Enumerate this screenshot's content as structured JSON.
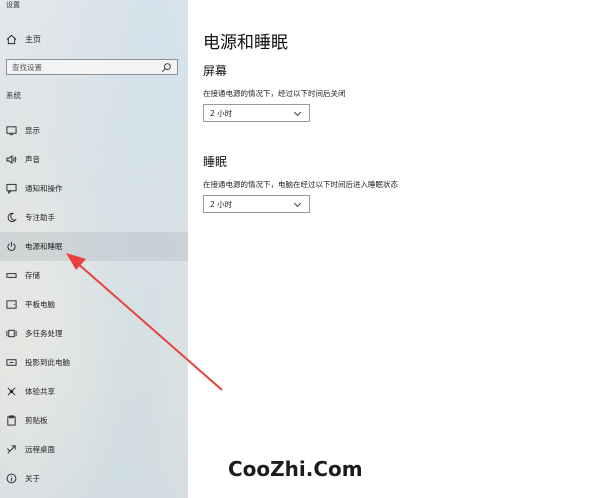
{
  "window": {
    "title": "设置"
  },
  "sidebar": {
    "home_label": "主页",
    "search_placeholder": "查找设置",
    "section_label": "系统",
    "items": [
      {
        "label": "显示",
        "icon": "display-icon"
      },
      {
        "label": "声音",
        "icon": "speaker-icon"
      },
      {
        "label": "通知和操作",
        "icon": "notification-icon"
      },
      {
        "label": "专注助手",
        "icon": "moon-icon"
      },
      {
        "label": "电源和睡眠",
        "icon": "power-icon",
        "selected": true
      },
      {
        "label": "存储",
        "icon": "storage-icon"
      },
      {
        "label": "平板电脑",
        "icon": "tablet-icon"
      },
      {
        "label": "多任务处理",
        "icon": "multitask-icon"
      },
      {
        "label": "投影到此电脑",
        "icon": "projector-icon"
      },
      {
        "label": "体验共享",
        "icon": "share-icon"
      },
      {
        "label": "剪贴板",
        "icon": "clipboard-icon"
      },
      {
        "label": "远程桌面",
        "icon": "remote-desktop-icon"
      },
      {
        "label": "关于",
        "icon": "info-icon"
      }
    ]
  },
  "main": {
    "title": "电源和睡眠",
    "screen": {
      "heading": "屏幕",
      "description": "在接通电源的情况下，经过以下时间后关闭",
      "value": "2 小时"
    },
    "sleep": {
      "heading": "睡眠",
      "description": "在接通电源的情况下，电脑在经过以下时间后进入睡眠状态",
      "value": "2 小时"
    }
  },
  "watermark": "CooZhi.Com",
  "colors": {
    "arrow": "#e8413c",
    "sidebar_bg": "#e0e4e6"
  }
}
